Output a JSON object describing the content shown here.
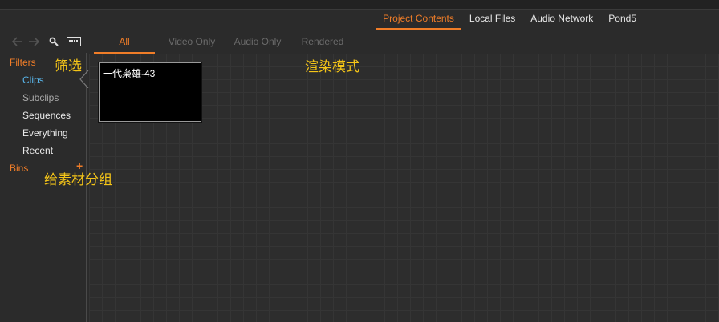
{
  "source_tabs": [
    "Project Contents",
    "Local Files",
    "Audio Network",
    "Pond5"
  ],
  "nav": {
    "back_icon": "arrow-left-icon",
    "forward_icon": "arrow-right-icon",
    "search_icon": "search-icon",
    "view_icon": "keyboard-view-icon"
  },
  "filter_tabs": [
    "All",
    "Video Only",
    "Audio Only",
    "Rendered"
  ],
  "sidebar": {
    "filters_header": "Filters",
    "filters": [
      "Clips",
      "Subclips",
      "Sequences",
      "Everything",
      "Recent"
    ],
    "bins_header": "Bins",
    "add_bin_label": "+"
  },
  "clips": [
    {
      "name": "一代枭雄-43"
    }
  ],
  "annotations": {
    "filter": "筛选",
    "render_mode": "渲染模式",
    "group": "给素材分组"
  },
  "colors": {
    "accent": "#f07d28",
    "selected": "#58b4e8",
    "annotation": "#f5c518",
    "background": "#2b2b2b"
  }
}
